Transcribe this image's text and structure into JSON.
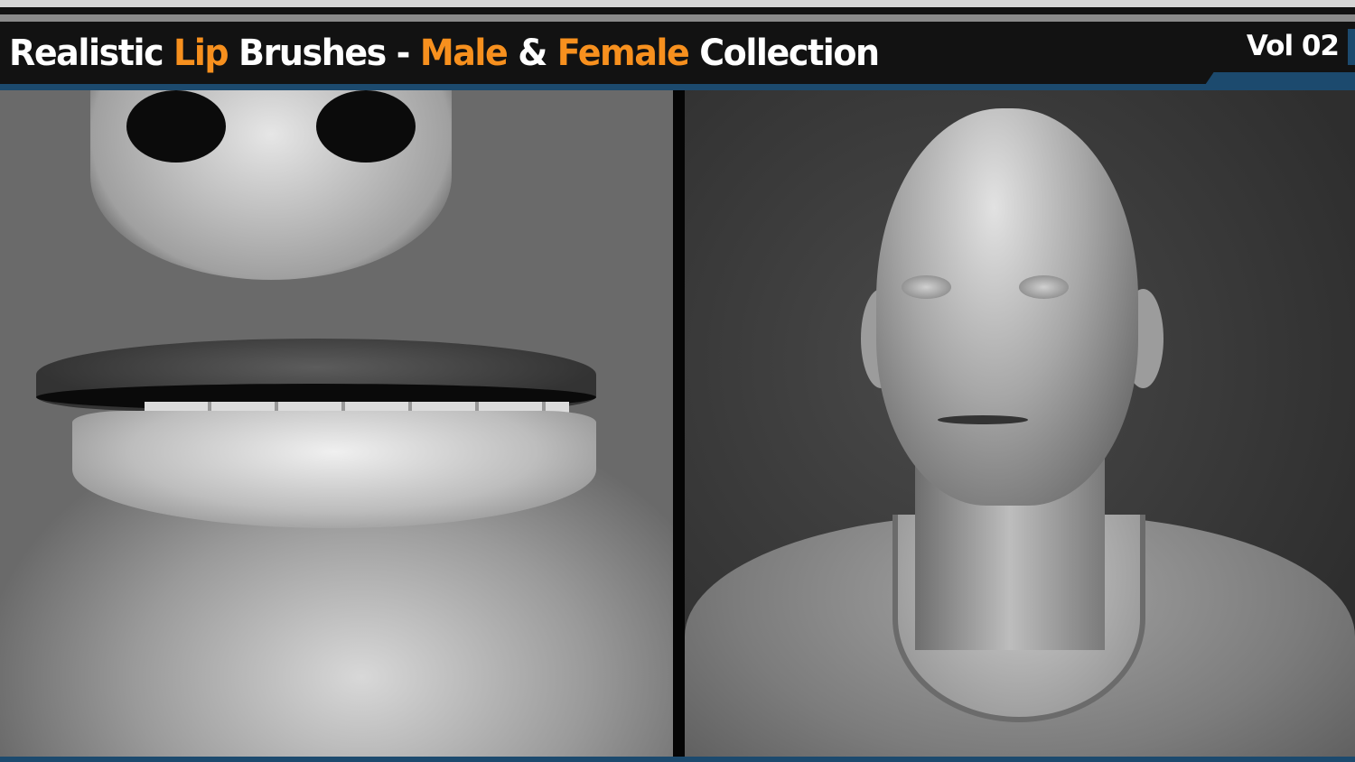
{
  "header": {
    "title_parts": [
      "Realistic ",
      "Lip",
      " Brushes - ",
      "Male",
      " & ",
      "Female",
      " Collection"
    ],
    "volume": "Vol 02"
  },
  "colors": {
    "accent": "#f7901e",
    "bar": "#1c4a6e",
    "header_bg": "#121212"
  },
  "panels": {
    "left": "lips-closeup-render",
    "right": "male-bust-render"
  }
}
